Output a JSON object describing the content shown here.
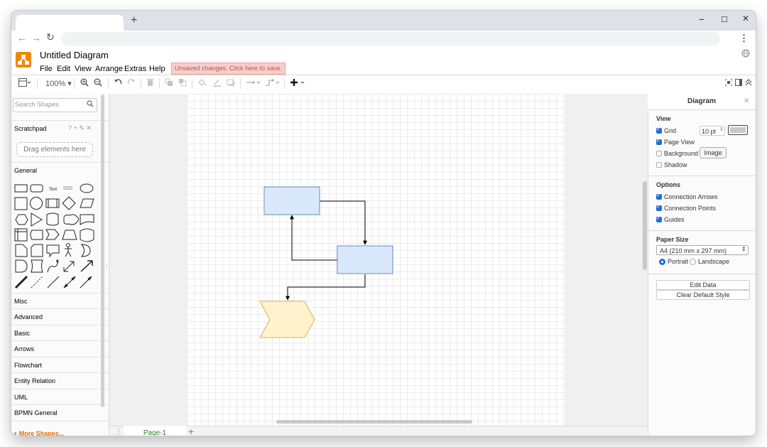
{
  "browser": {
    "new_tab": "+",
    "minimize": "−",
    "maximize": "☐",
    "close": "✕",
    "back": "←",
    "forward": "→",
    "reload": "↻",
    "menu": "⋮"
  },
  "app": {
    "title": "Untitled Diagram",
    "menus": [
      "File",
      "Edit",
      "View",
      "Arrange",
      "Extras",
      "Help"
    ],
    "unsaved": "Unsaved changes. Click here to save.",
    "accent": "#f08705"
  },
  "toolbar": {
    "zoom": "100%",
    "icons": [
      "format-panel-icon",
      "zoom-in-icon",
      "zoom-out-icon",
      "undo-icon",
      "redo-icon",
      "delete-icon",
      "to-front-icon",
      "to-back-icon",
      "fill-color-icon",
      "line-color-icon",
      "shadow-icon",
      "connection-icon",
      "waypoints-icon",
      "insert-icon"
    ]
  },
  "left_panel": {
    "search_placeholder": "Search Shapes",
    "scratchpad": "Scratchpad",
    "scratchpad_tools": "? + ✎ ✕",
    "drop_hint": "Drag elements here",
    "general": "General",
    "text_shape": "Text",
    "sections": [
      "Misc",
      "Advanced",
      "Basic",
      "Arrows",
      "Flowchart",
      "Entity Relation",
      "UML",
      "BPMN General"
    ],
    "more_shapes": "+ More Shapes..."
  },
  "pages": {
    "active": "Page-1",
    "add": "+"
  },
  "format_panel": {
    "title": "Diagram",
    "view_heading": "View",
    "grid": "Grid",
    "grid_size": "10 pt",
    "page_view": "Page View",
    "background": "Background",
    "image_button": "Image",
    "shadow": "Shadow",
    "options_heading": "Options",
    "connection_arrows": "Connection Arrows",
    "connection_points": "Connection Points",
    "guides": "Guides",
    "paper_heading": "Paper Size",
    "paper_value": "A4 (210 mm x 297 mm)",
    "portrait": "Portrait",
    "landscape": "Landscape",
    "edit_data": "Edit Data",
    "clear_style": "Clear Default Style"
  },
  "diagram": {
    "box_fill": "#dae8fc",
    "box_stroke": "#6c8ebf",
    "step_fill": "#fff2cc",
    "step_stroke": "#d6b656"
  }
}
